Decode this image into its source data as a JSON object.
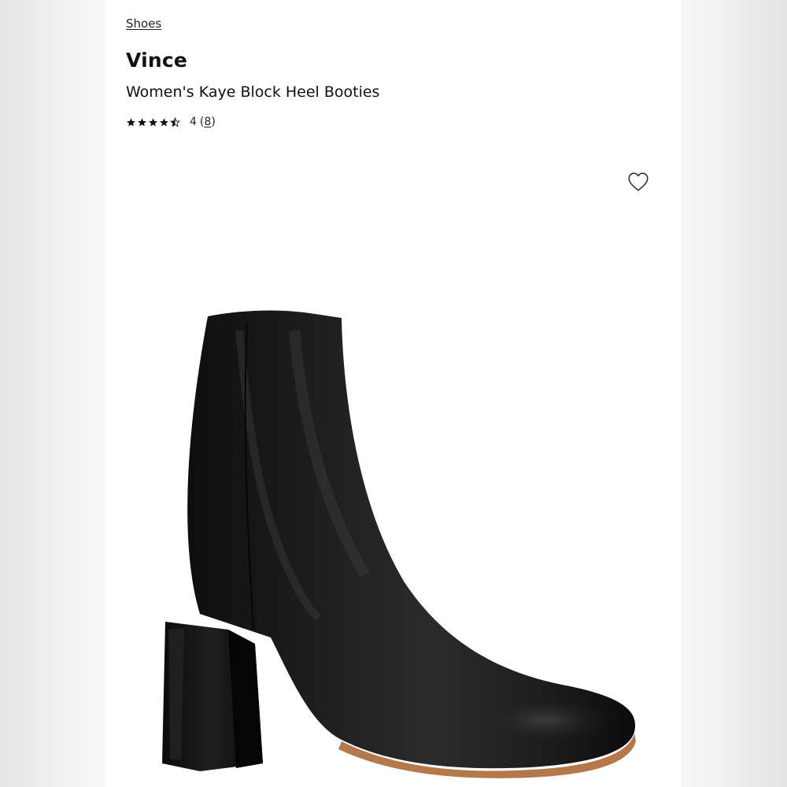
{
  "breadcrumb": {
    "label": "Shoes"
  },
  "product": {
    "brand": "Vince",
    "name": "Women's Kaye Block Heel Booties",
    "rating": {
      "value": "4",
      "count": "8",
      "stars_filled": 4.5,
      "stars_total": 5
    },
    "image": {
      "alt": "black leather block heel bootie"
    }
  },
  "icons": {
    "wishlist": "heart-outline-icon",
    "star": "star-icon"
  },
  "colors": {
    "background": "#ffffff",
    "text": "#111111",
    "boot_leather": "#1a1a1a",
    "sole": "#b5784a"
  }
}
